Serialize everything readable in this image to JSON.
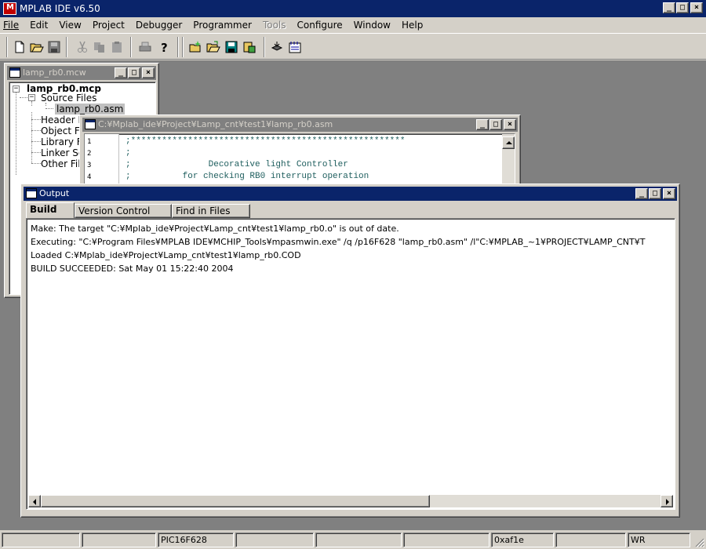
{
  "app": {
    "title": "MPLAB IDE v6.50"
  },
  "menu": [
    {
      "label": "File",
      "enabled": true
    },
    {
      "label": "Edit",
      "enabled": true
    },
    {
      "label": "View",
      "enabled": true
    },
    {
      "label": "Project",
      "enabled": true
    },
    {
      "label": "Debugger",
      "enabled": true
    },
    {
      "label": "Programmer",
      "enabled": true
    },
    {
      "label": "Tools",
      "enabled": false
    },
    {
      "label": "Configure",
      "enabled": true
    },
    {
      "label": "Window",
      "enabled": true
    },
    {
      "label": "Help",
      "enabled": true
    }
  ],
  "toolbar": {
    "icons": [
      "new-file-icon",
      "open-file-icon",
      "save-icon",
      "cut-icon",
      "copy-icon",
      "paste-icon",
      "print-icon",
      "help-icon",
      "new-project-icon",
      "open-project-icon",
      "save-project-icon",
      "build-project-icon",
      "make-icon",
      "build-all-icon"
    ]
  },
  "workspace_window": {
    "title": "lamp_rb0.mcw",
    "tree": {
      "root": "lamp_rb0.mcp",
      "folders": [
        "Source Files",
        "Header F",
        "Object Fi",
        "Library Fi",
        "Linker Sc",
        "Other File"
      ],
      "source_file": "lamp_rb0.asm"
    }
  },
  "editor_window": {
    "title": "C:¥Mplab_ide¥Project¥Lamp_cnt¥test1¥lamp_rb0.asm",
    "lines": [
      {
        "n": "1",
        "text": ";*****************************************************"
      },
      {
        "n": "2",
        "text": ";"
      },
      {
        "n": "3",
        "text": ";               Decorative light Controller"
      },
      {
        "n": "4",
        "text": ";          for checking RB0 interrupt operation"
      }
    ]
  },
  "output_window": {
    "title": "Output",
    "tabs": [
      "Build",
      "Version Control",
      "Find in Files"
    ],
    "active_tab": "Build",
    "lines": [
      "Make: The target \"C:¥Mplab_ide¥Project¥Lamp_cnt¥test1¥lamp_rb0.o\" is out of date.",
      "Executing: \"C:¥Program Files¥MPLAB IDE¥MCHIP_Tools¥mpasmwin.exe\" /q /p16F628 \"lamp_rb0.asm\" /l\"C:¥MPLAB_~1¥PROJECT¥LAMP_CNT¥T",
      "Loaded C:¥Mplab_ide¥Project¥Lamp_cnt¥test1¥lamp_rb0.COD",
      "BUILD SUCCEEDED: Sat May 01 15:22:40 2004"
    ]
  },
  "statusbar": {
    "device": "PIC16F628",
    "checksum": "0xaf1e",
    "mode": "WR"
  },
  "colors": {
    "titlebar_active": "#0a246a",
    "titlebar_inactive": "#808080",
    "mdi_background": "#808080",
    "face": "#d4d0c8"
  }
}
